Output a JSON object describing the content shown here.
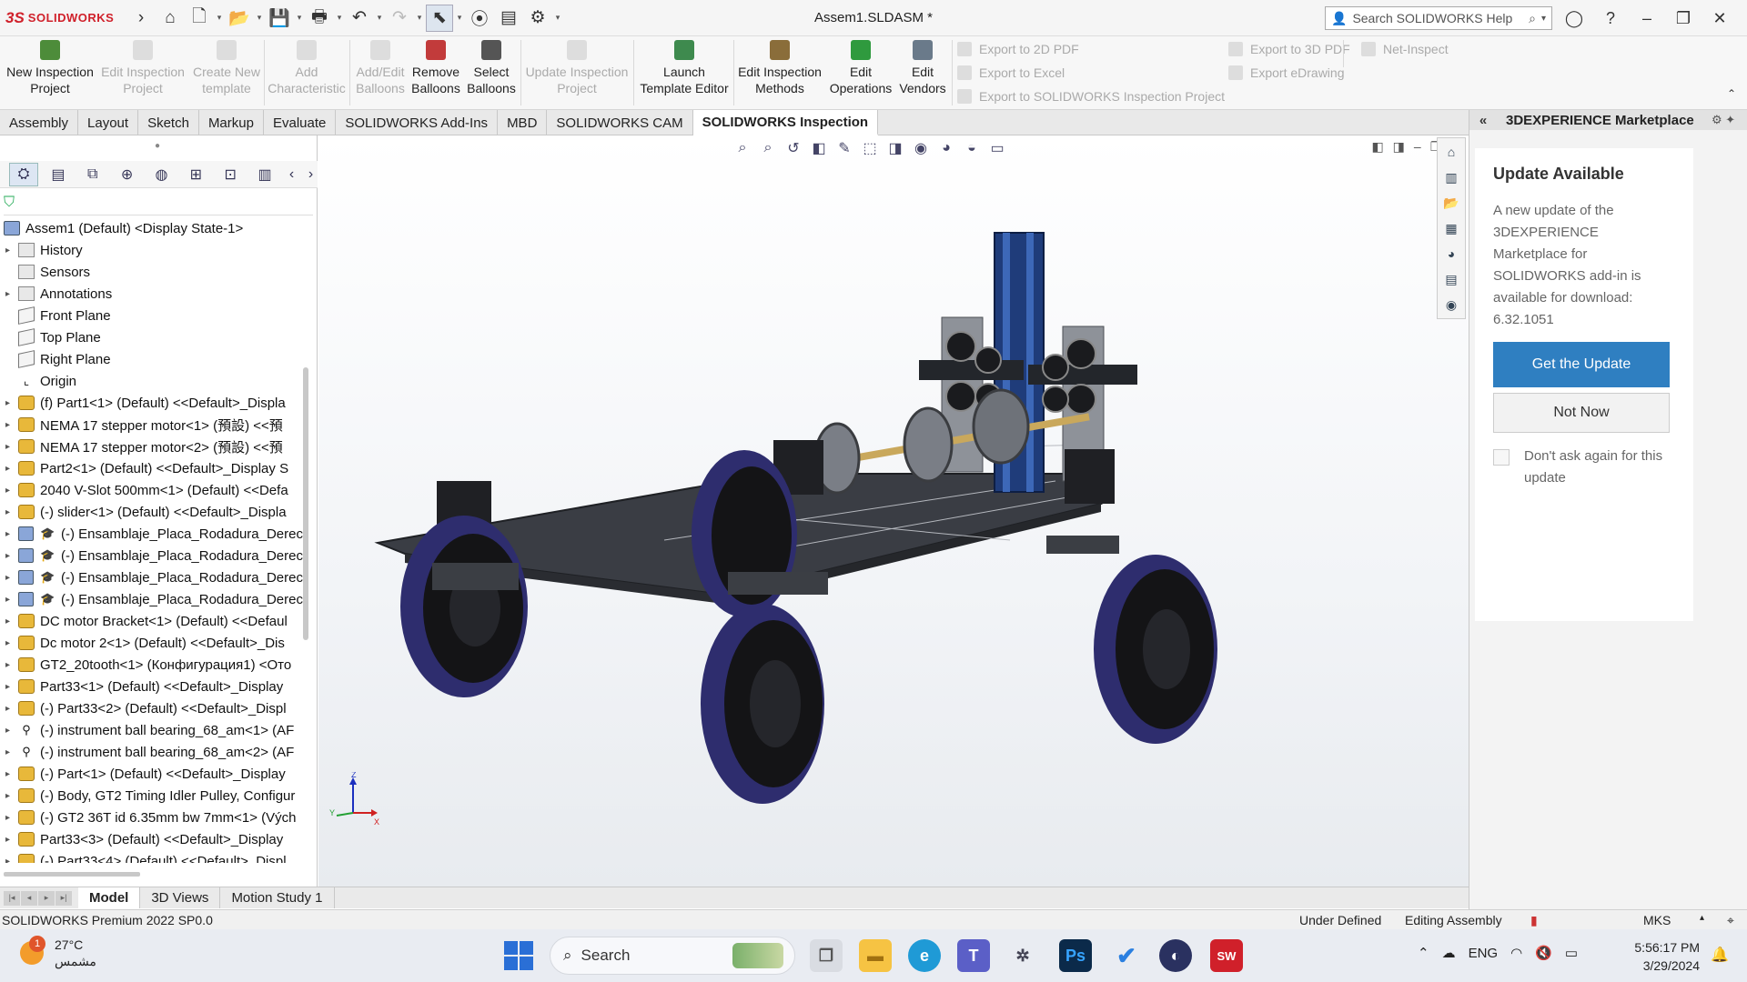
{
  "app": {
    "brand": "SOLIDWORKS",
    "document_title": "Assem1.SLDASM *",
    "help_search_placeholder": "Search SOLIDWORKS Help"
  },
  "ribbon": {
    "buttons": [
      {
        "label1": "New Inspection",
        "label2": "Project",
        "enabled": true
      },
      {
        "label1": "Edit Inspection",
        "label2": "Project",
        "enabled": false
      },
      {
        "label1": "Create New",
        "label2": "template",
        "enabled": false
      },
      {
        "label1": "Add",
        "label2": "Characteristic",
        "enabled": false
      },
      {
        "label1": "Add/Edit",
        "label2": "Balloons",
        "enabled": false
      },
      {
        "label1": "Remove",
        "label2": "Balloons",
        "enabled": true
      },
      {
        "label1": "Select",
        "label2": "Balloons",
        "enabled": true
      },
      {
        "label1": "Update Inspection",
        "label2": "Project",
        "enabled": false
      },
      {
        "label1": "Launch",
        "label2": "Template Editor",
        "enabled": true
      },
      {
        "label1": "Edit Inspection",
        "label2": "Methods",
        "enabled": true
      },
      {
        "label1": "Edit",
        "label2": "Operations",
        "enabled": true
      },
      {
        "label1": "Edit",
        "label2": "Vendors",
        "enabled": true
      }
    ],
    "export": {
      "pdf2d": "Export to 2D PDF",
      "excel": "Export to Excel",
      "sw_inspection": "Export to SOLIDWORKS Inspection Project",
      "pdf3d": "Export to 3D PDF",
      "edrawing": "Export eDrawing",
      "net_inspect": "Net-Inspect"
    }
  },
  "tabs": [
    "Assembly",
    "Layout",
    "Sketch",
    "Markup",
    "Evaluate",
    "SOLIDWORKS Add-Ins",
    "MBD",
    "SOLIDWORKS CAM",
    "SOLIDWORKS Inspection"
  ],
  "active_tab": "SOLIDWORKS Inspection",
  "tree": {
    "root": "Assem1 (Default) <Display State-1>",
    "items": [
      {
        "text": "History",
        "icon": "folder",
        "exp": "▸"
      },
      {
        "text": "Sensors",
        "icon": "folder",
        "exp": ""
      },
      {
        "text": "Annotations",
        "icon": "folder",
        "exp": "▸"
      },
      {
        "text": "Front Plane",
        "icon": "plane",
        "exp": ""
      },
      {
        "text": "Top Plane",
        "icon": "plane",
        "exp": ""
      },
      {
        "text": "Right Plane",
        "icon": "plane",
        "exp": ""
      },
      {
        "text": "Origin",
        "icon": "origin",
        "exp": ""
      },
      {
        "text": "(f) Part1<1> (Default) <<Default>_Displa",
        "icon": "part",
        "exp": "▸"
      },
      {
        "text": "NEMA 17 stepper motor<1> (預設) <<預",
        "icon": "part",
        "exp": "▸"
      },
      {
        "text": "NEMA 17 stepper motor<2> (預設) <<預",
        "icon": "part",
        "exp": "▸"
      },
      {
        "text": "Part2<1> (Default) <<Default>_Display S",
        "icon": "part",
        "exp": "▸"
      },
      {
        "text": "2040 V-Slot 500mm<1> (Default) <<Defa",
        "icon": "part",
        "exp": "▸"
      },
      {
        "text": "(-) slider<1> (Default) <<Default>_Displa",
        "icon": "part",
        "exp": "▸"
      },
      {
        "text": "(-) Ensamblaje_Placa_Rodadura_Derec",
        "icon": "sub",
        "exp": "▸"
      },
      {
        "text": "(-) Ensamblaje_Placa_Rodadura_Derec",
        "icon": "sub",
        "exp": "▸"
      },
      {
        "text": "(-) Ensamblaje_Placa_Rodadura_Derec",
        "icon": "sub",
        "exp": "▸"
      },
      {
        "text": "(-) Ensamblaje_Placa_Rodadura_Derec",
        "icon": "sub",
        "exp": "▸"
      },
      {
        "text": "DC motor Bracket<1> (Default) <<Defaul",
        "icon": "part",
        "exp": "▸"
      },
      {
        "text": "Dc motor 2<1> (Default) <<Default>_Dis",
        "icon": "part",
        "exp": "▸"
      },
      {
        "text": "GT2_20tooth<1> (Конфигурация1) <Ото",
        "icon": "part",
        "exp": "▸"
      },
      {
        "text": "Part33<1> (Default) <<Default>_Display",
        "icon": "part",
        "exp": "▸"
      },
      {
        "text": "(-) Part33<2> (Default) <<Default>_Displ",
        "icon": "part",
        "exp": "▸"
      },
      {
        "text": "(-) instrument ball bearing_68_am<1> (AF",
        "icon": "pin",
        "exp": "▸"
      },
      {
        "text": "(-) instrument ball bearing_68_am<2> (AF",
        "icon": "pin",
        "exp": "▸"
      },
      {
        "text": "(-) Part<1> (Default) <<Default>_Display",
        "icon": "part",
        "exp": "▸"
      },
      {
        "text": "(-) Body, GT2 Timing Idler Pulley, Configur",
        "icon": "part",
        "exp": "▸"
      },
      {
        "text": "(-) GT2 36T id 6.35mm bw 7mm<1> (Vých",
        "icon": "part",
        "exp": "▸"
      },
      {
        "text": "Part33<3> (Default) <<Default>_Display",
        "icon": "part",
        "exp": "▸"
      },
      {
        "text": "(-) Part33<4> (Default) <<Default>_Displ",
        "icon": "part",
        "exp": "▸"
      }
    ]
  },
  "model_tabs": [
    "Model",
    "3D Views",
    "Motion Study 1"
  ],
  "status": {
    "product": "SOLIDWORKS Premium 2022 SP0.0",
    "state": "Under Defined",
    "mode": "Editing Assembly",
    "units": "MKS"
  },
  "taskpane": {
    "title": "3DEXPERIENCE Marketplace",
    "update_title": "Update Available",
    "update_message": "A new update of the 3DEXPERIENCE Marketplace for SOLIDWORKS add-in is available for download: 6.32.1051",
    "get_update": "Get the Update",
    "not_now": "Not Now",
    "dont_ask": "Don't ask again for this update"
  },
  "triad": {
    "x": "X",
    "y": "Y",
    "z": "Z"
  },
  "taskbar": {
    "temperature": "27°C",
    "weather_desc": "مشمس",
    "weather_badge": "1",
    "search": "Search",
    "lang": "ENG",
    "time": "5:56:17 PM",
    "date": "3/29/2024"
  }
}
